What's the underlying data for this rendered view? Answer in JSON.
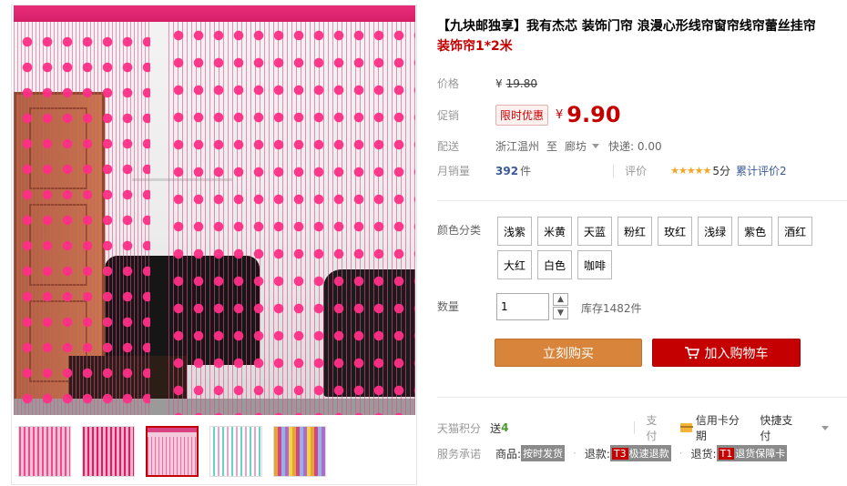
{
  "product": {
    "title_prefix": "【九块邮独享】我有杰芯 装饰门帘 浪漫心形线帘窗帘线帘蕾丝挂帘",
    "title_suffix": "装饰帘1*2米"
  },
  "price": {
    "label": "价格",
    "yen": "¥",
    "original": "19.80"
  },
  "promo": {
    "label": "促销",
    "tag": "限时优惠",
    "yen": "¥",
    "price": "9.90"
  },
  "shipping": {
    "label": "配送",
    "from": "浙江温州",
    "to_word": "至",
    "to": "廊坊",
    "fee": "快递: 0.00"
  },
  "sales": {
    "label": "月销量",
    "count": "392",
    "unit": "件",
    "review_label": "评价",
    "stars": "★★★★★",
    "score": "5分",
    "cumulative": "累计评价2"
  },
  "sku": {
    "label": "颜色分类",
    "options": [
      "浅紫",
      "米黄",
      "天蓝",
      "粉红",
      "玫红",
      "浅绿",
      "紫色",
      "酒红",
      "大红",
      "白色",
      "咖啡"
    ]
  },
  "quantity": {
    "label": "数量",
    "value": "1",
    "up": "▲",
    "down": "▼",
    "stock": "库存1482件"
  },
  "buttons": {
    "buy": "立刻购买",
    "cart": "加入购物车"
  },
  "points": {
    "label": "天猫积分",
    "send": "送",
    "amount": "4",
    "pay_label": "支付",
    "credit": "信用卡分期",
    "quick": "快捷支付"
  },
  "service": {
    "label": "服务承诺",
    "goods_label": "商品:",
    "goods_badge": "按时发货",
    "refund_label": "退款:",
    "refund_tag": "T3",
    "refund_badge": "极速退款",
    "return_label": "退货:",
    "return_tag": "T1",
    "return_badge": "退货保障卡"
  },
  "colors": {
    "accent": "#c40000",
    "buy_button": "#d9843b",
    "curtain_pink": "#ff2f86"
  }
}
